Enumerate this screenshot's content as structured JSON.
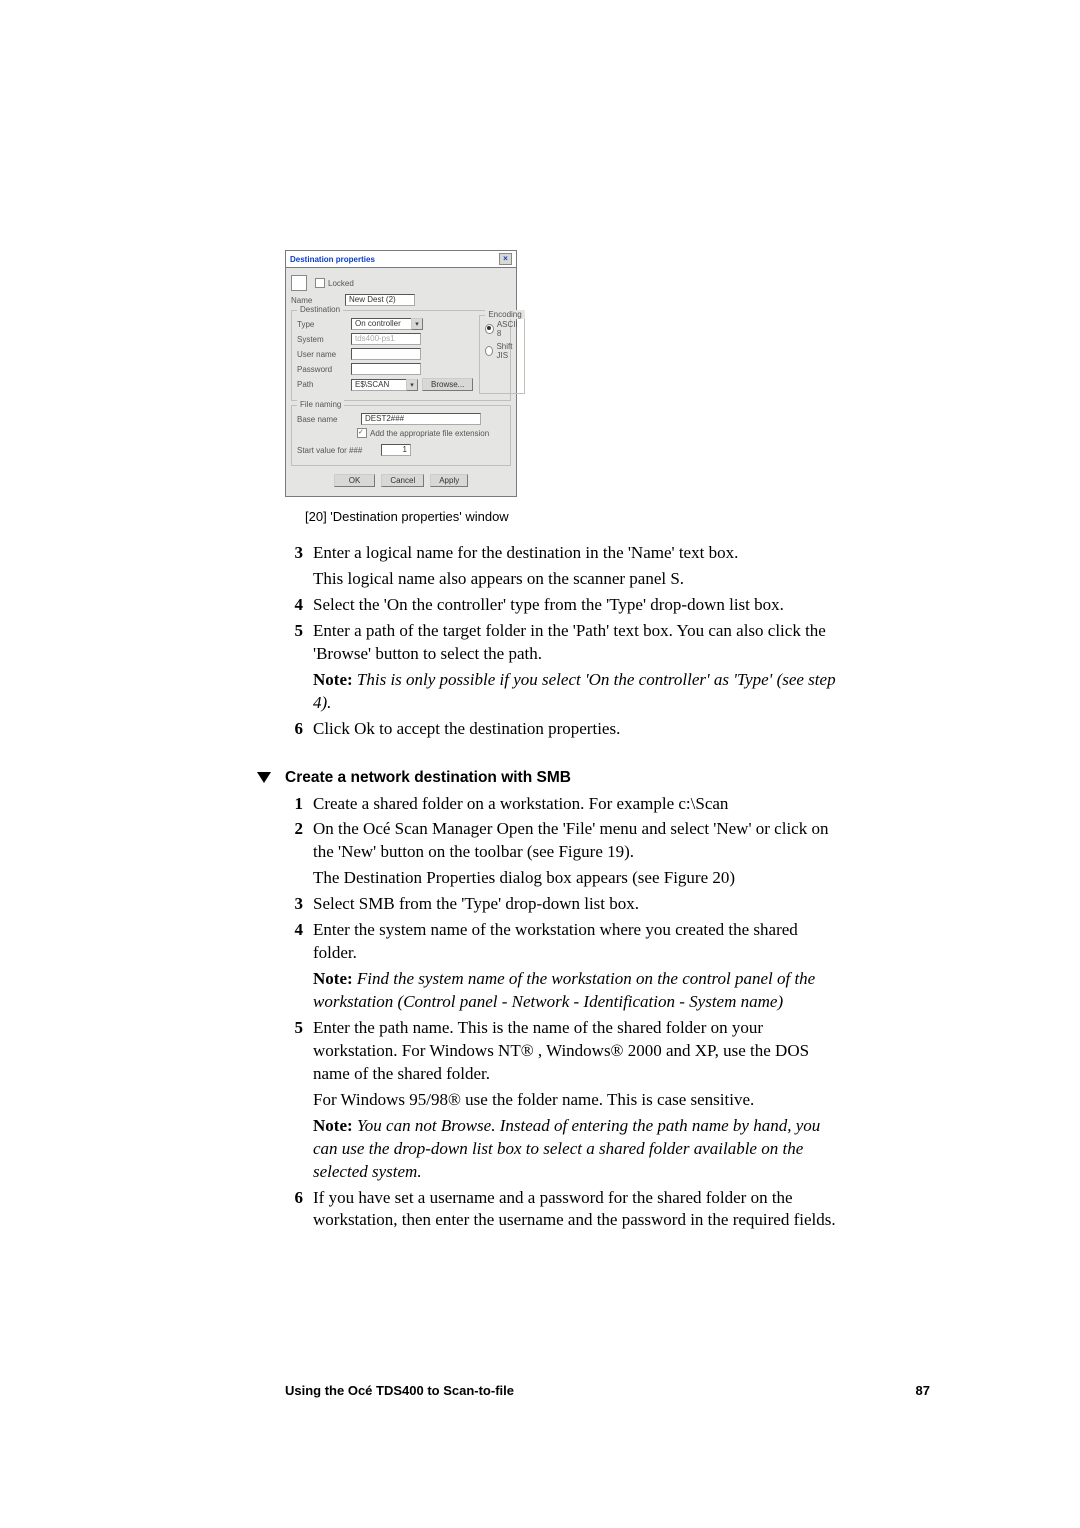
{
  "dialog": {
    "title": "Destination properties",
    "locked": "Locked",
    "name_lbl": "Name",
    "name_val": "New Dest (2)",
    "grp_dest": "Destination",
    "type_lbl": "Type",
    "type_val": "On controller",
    "system_lbl": "System",
    "system_val": "tds400-ps1",
    "user_lbl": "User name",
    "pwd_lbl": "Password",
    "path_lbl": "Path",
    "path_val": "E$\\SCAN",
    "browse": "Browse...",
    "grp_enc": "Encoding",
    "enc_ascii": "ASCII 8",
    "enc_shift": "Shift JIS",
    "grp_file": "File naming",
    "base_lbl": "Base name",
    "base_val": "DEST2###",
    "add_ext": "Add the appropriate file extension",
    "start_lbl": "Start value for ###",
    "start_val": "1",
    "ok": "OK",
    "cancel": "Cancel",
    "apply": "Apply"
  },
  "caption": "[20] 'Destination properties' window",
  "steps_a": [
    {
      "n": "3",
      "lines": [
        "Enter a logical name for the destination in the 'Name' text box.",
        "This logical name also appears on the scanner panel S."
      ]
    },
    {
      "n": "4",
      "lines": [
        "Select the 'On the controller' type from the 'Type' drop-down list box."
      ]
    },
    {
      "n": "5",
      "lines": [
        "Enter a path of the target folder in the 'Path' text box. You can also click the 'Browse' button to select the path."
      ],
      "note": "This is only possible if you select 'On the controller' as 'Type' (see step 4)."
    },
    {
      "n": "6",
      "lines": [
        "Click Ok to accept the destination properties."
      ]
    }
  ],
  "section_title": "Create a network destination with SMB",
  "steps_b": [
    {
      "n": "1",
      "lines": [
        "Create a shared folder on a workstation. For example c:\\Scan"
      ]
    },
    {
      "n": "2",
      "lines": [
        "On the Océ Scan Manager Open the 'File' menu and select 'New' or click on the 'New' button on the toolbar (see Figure 19).",
        "The Destination Properties dialog box appears (see Figure 20)"
      ]
    },
    {
      "n": "3",
      "lines": [
        "Select SMB from the 'Type' drop-down list box."
      ]
    },
    {
      "n": "4",
      "lines": [
        "Enter the system name of the workstation where you created the shared folder."
      ],
      "note": "Find the system name of the workstation on the control panel of the workstation (Control panel - Network - Identification - System name)"
    },
    {
      "n": "5",
      "lines": [
        "Enter the path name. This is the name of the shared folder on your workstation. For Windows NT® , Windows® 2000 and XP, use the DOS name of the shared folder.",
        "For Windows 95/98® use the folder name. This is case sensitive."
      ],
      "note": "You can not Browse. Instead of entering the path name by hand, you can use the drop-down list box to select a shared folder available on the selected system."
    },
    {
      "n": "6",
      "lines": [
        "If you have set a username and a password for the shared folder on the workstation, then enter the username and the password in the required fields."
      ]
    }
  ],
  "note_label": "Note:",
  "footer_left": "Using the Océ TDS400 to Scan-to-file",
  "footer_right": "87"
}
